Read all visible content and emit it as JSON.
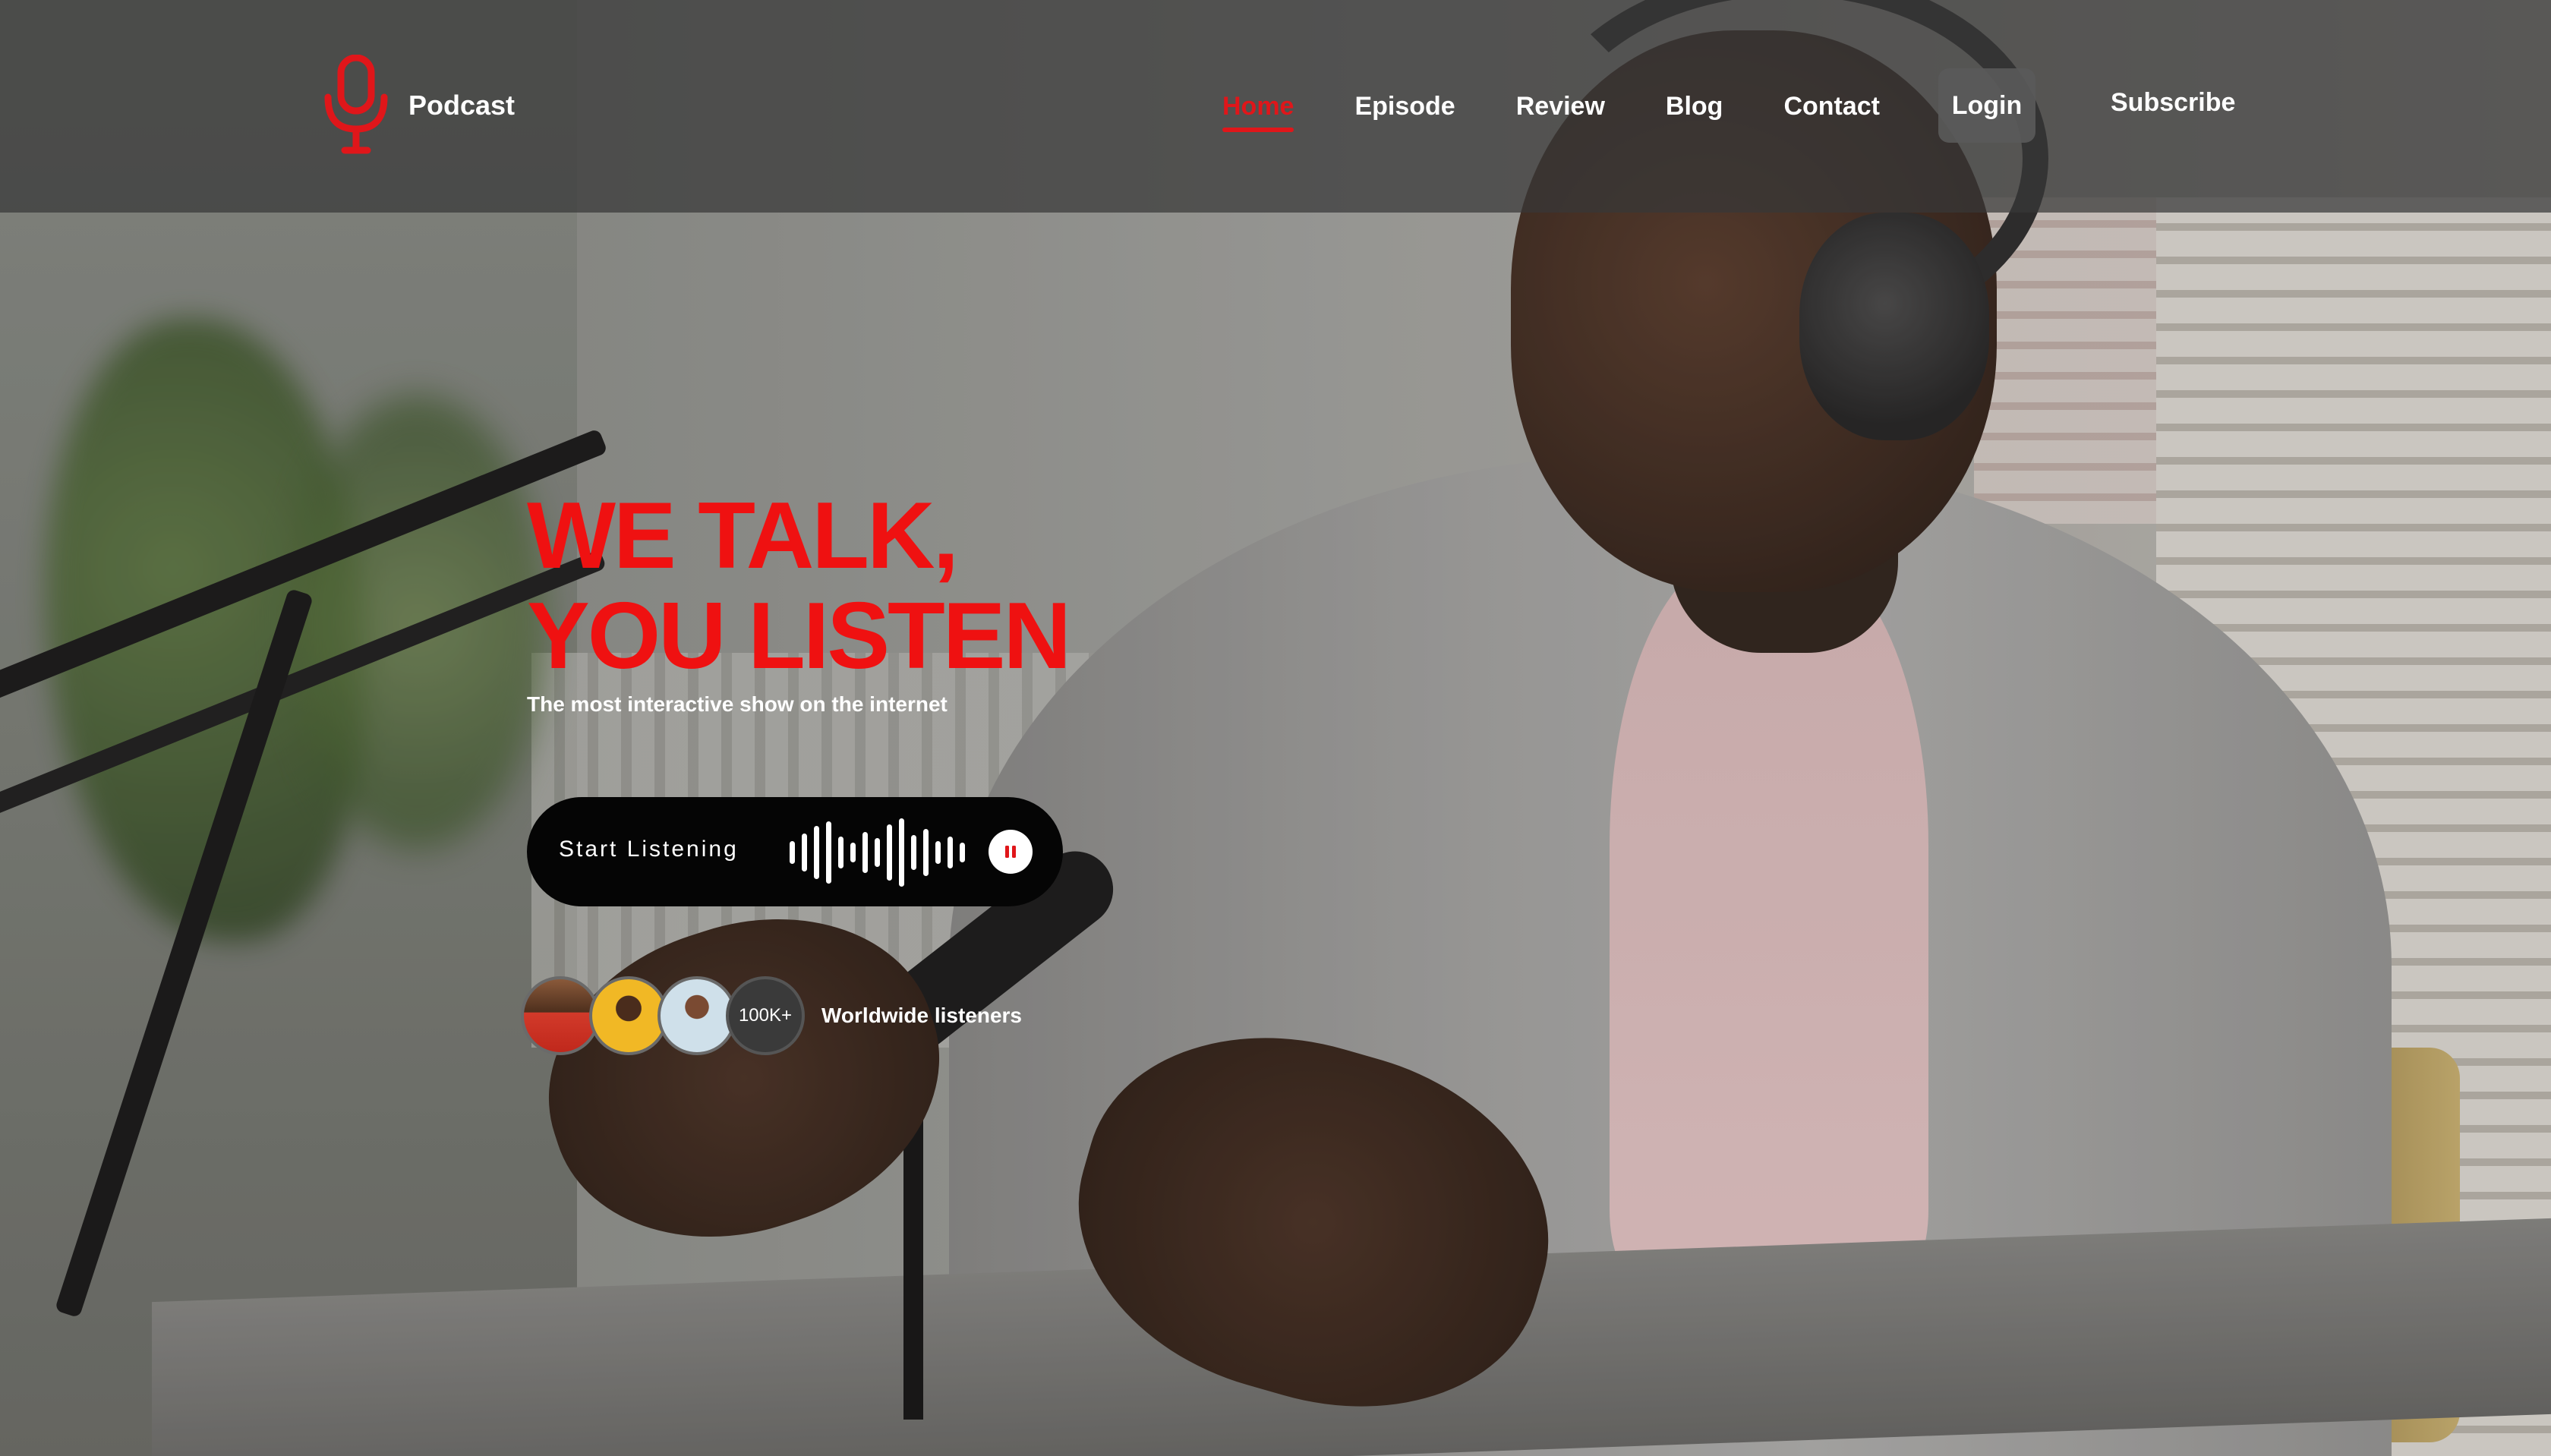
{
  "brand": {
    "name": "Podcast",
    "accent_color": "#e0161a"
  },
  "nav": {
    "items": [
      {
        "label": "Home",
        "active": true
      },
      {
        "label": "Episode",
        "active": false
      },
      {
        "label": "Review",
        "active": false
      },
      {
        "label": "Blog",
        "active": false
      },
      {
        "label": "Contact",
        "active": false
      }
    ],
    "login_label": "Login",
    "subscribe_label": "Subscribe"
  },
  "hero": {
    "title_line1": "WE TALK,",
    "title_line2": "YOU LISTEN",
    "subtitle": "The most interactive show on the internet",
    "title_color": "#ef1111"
  },
  "player": {
    "label": "Start Listening",
    "wave_icon": "sound-wave-icon",
    "control_icon": "pause-icon"
  },
  "listeners": {
    "count": "100K+",
    "label": "Worldwide listeners"
  }
}
